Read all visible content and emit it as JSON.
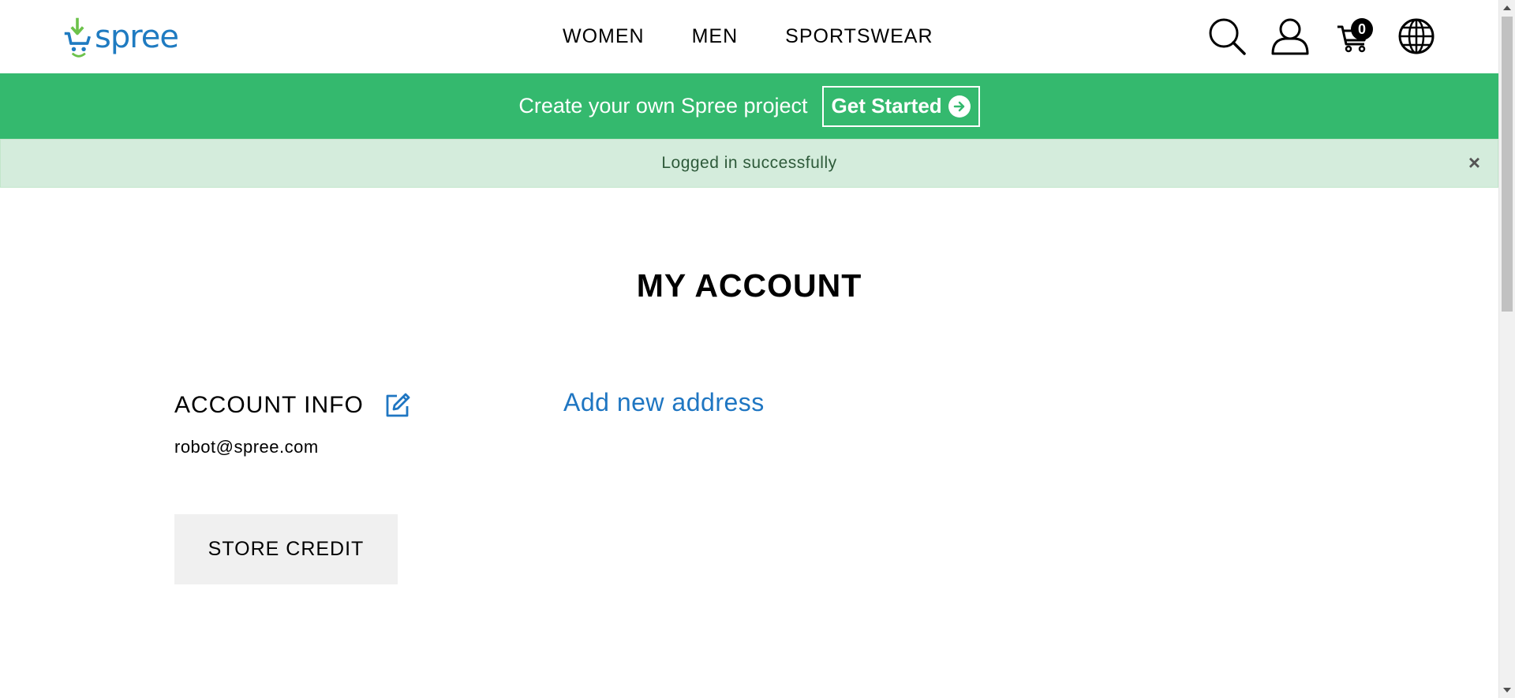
{
  "header": {
    "logo_text": "spree",
    "nav": [
      {
        "label": "WOMEN"
      },
      {
        "label": "MEN"
      },
      {
        "label": "SPORTSWEAR"
      }
    ],
    "icons": {
      "search": "search-icon",
      "account": "user-icon",
      "cart": "cart-icon",
      "locale": "globe-icon"
    },
    "cart_count": "0"
  },
  "promo": {
    "text": "Create your own Spree project",
    "button_label": "Get Started",
    "background": "#34b96e"
  },
  "flash": {
    "message": "Logged in successfully",
    "close_label": "×"
  },
  "main": {
    "title": "MY ACCOUNT",
    "account_info_heading": "ACCOUNT INFO",
    "email": "robot@spree.com",
    "store_credit_label": "STORE CREDIT",
    "add_address_label": "Add new address"
  },
  "colors": {
    "accent_blue": "#1f76c2",
    "logo_green": "#6cc24a",
    "flash_bg": "#d4ecdc"
  }
}
